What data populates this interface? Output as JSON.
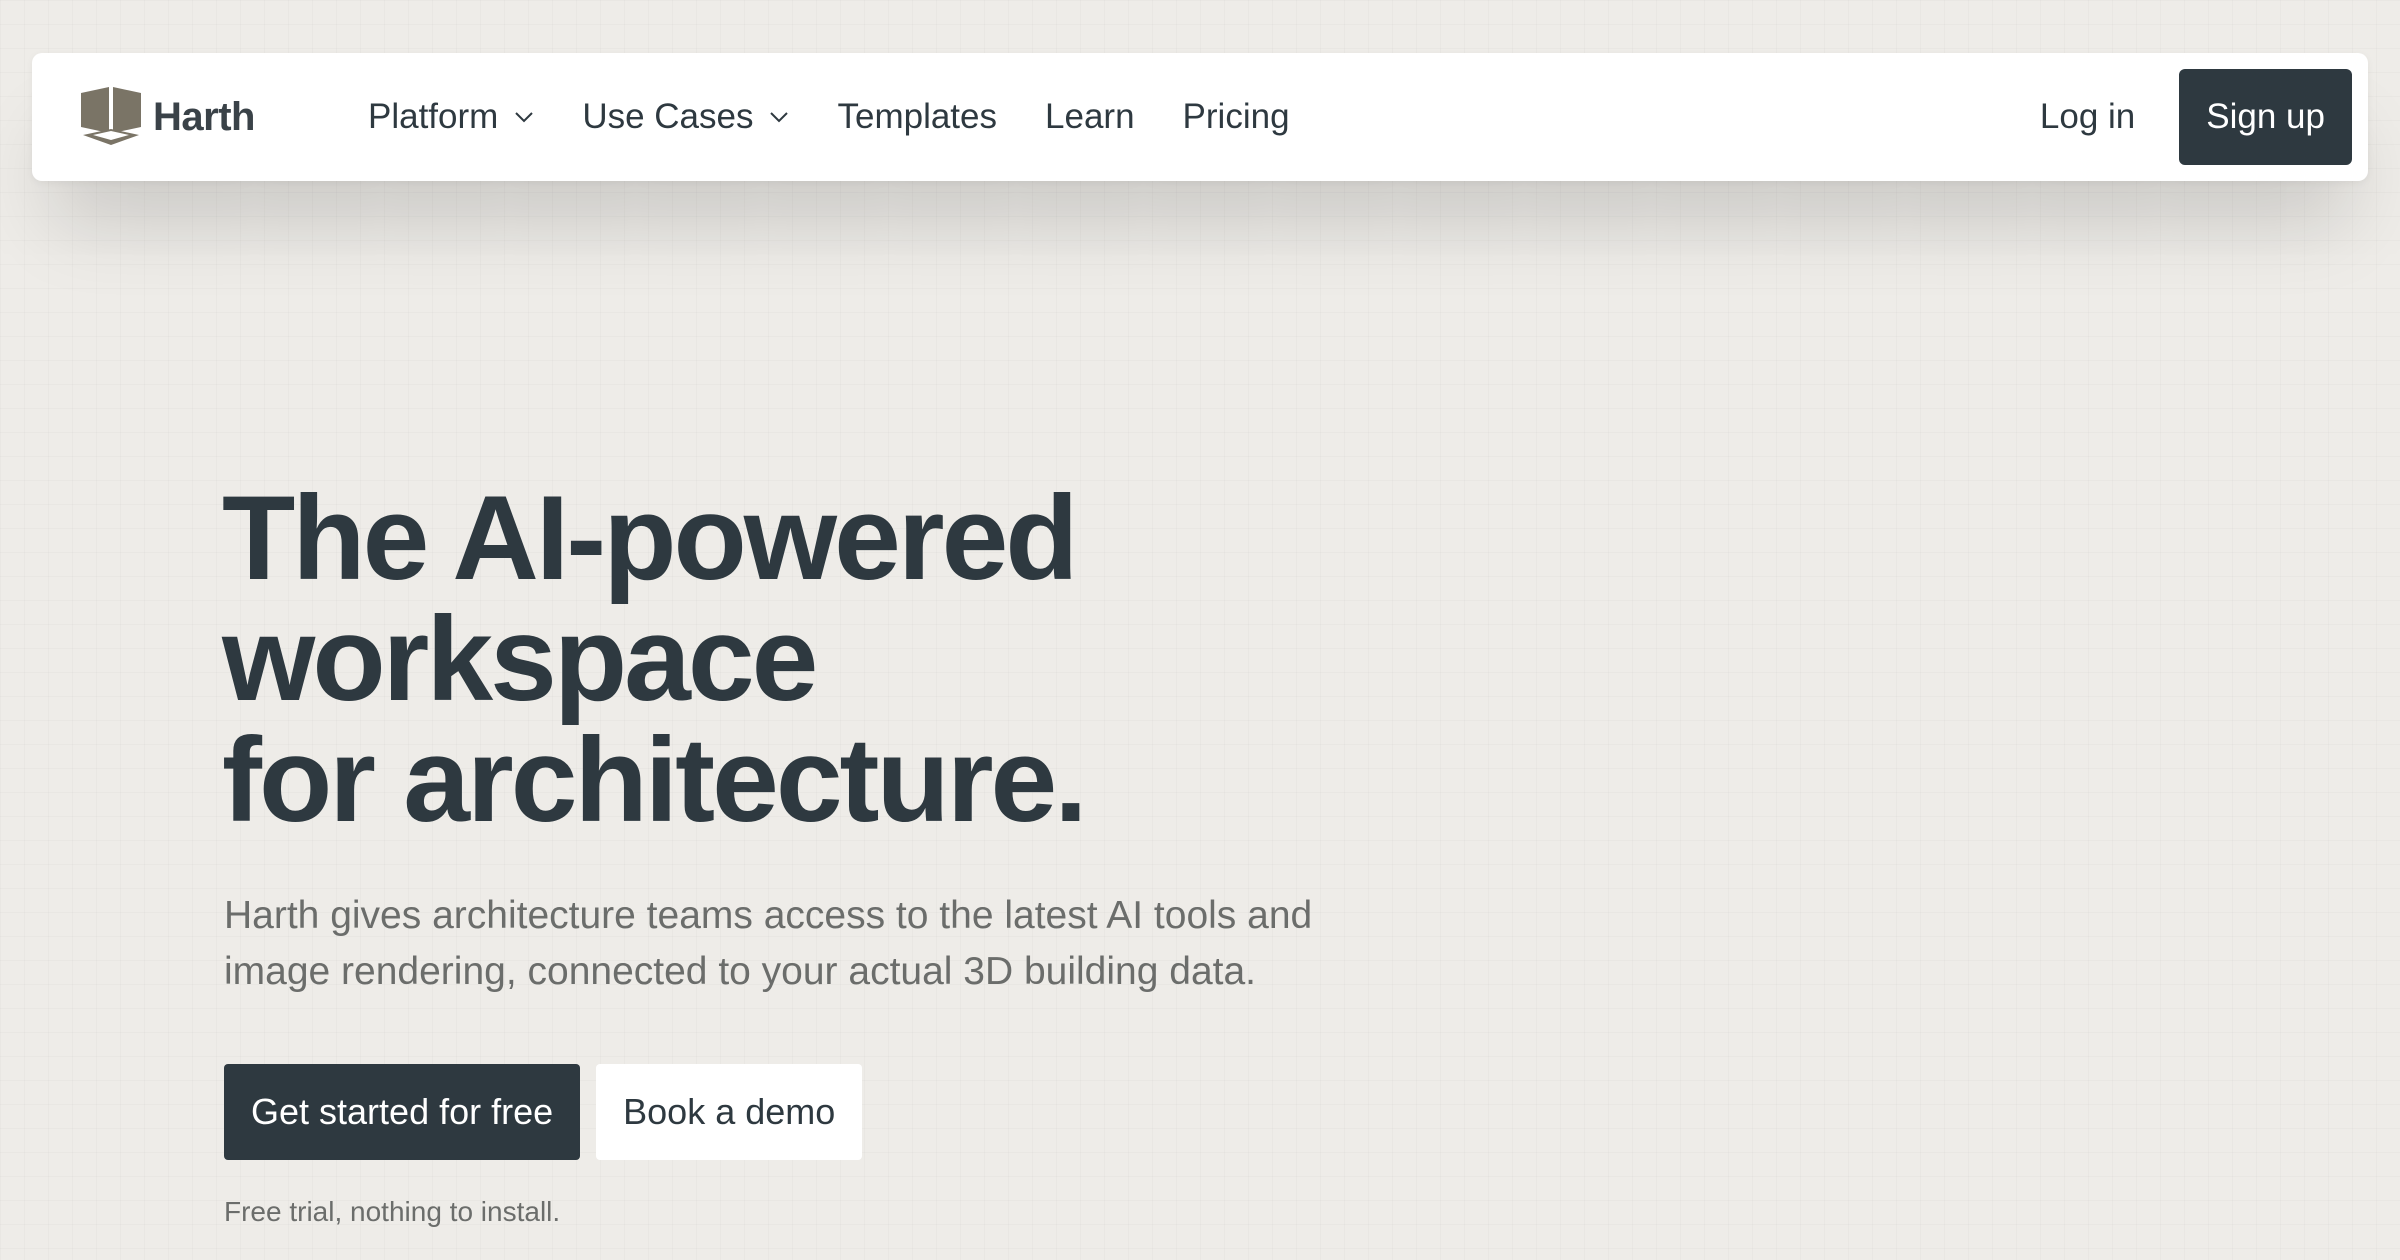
{
  "brand": {
    "name": "Harth",
    "logo_icon": "cube-logo-icon",
    "logo_color": "#7a7466"
  },
  "nav": {
    "items": [
      {
        "label": "Platform",
        "has_dropdown": true
      },
      {
        "label": "Use Cases",
        "has_dropdown": true
      },
      {
        "label": "Templates",
        "has_dropdown": false
      },
      {
        "label": "Learn",
        "has_dropdown": false
      },
      {
        "label": "Pricing",
        "has_dropdown": false
      }
    ],
    "login_label": "Log in",
    "signup_label": "Sign up"
  },
  "hero": {
    "title_lines": [
      "The AI-powered",
      "workspace",
      "for architecture."
    ],
    "subtitle": "Harth gives architecture teams access to the latest AI tools and image rendering, connected to your actual 3D building data.",
    "primary_cta": "Get started for free",
    "secondary_cta": "Book a demo",
    "note": "Free trial, nothing to install."
  },
  "colors": {
    "background": "#eeece8",
    "text_dark": "#2e3940",
    "text_muted": "#6b6d6b",
    "button_dark": "#2e3940",
    "surface": "#ffffff"
  }
}
